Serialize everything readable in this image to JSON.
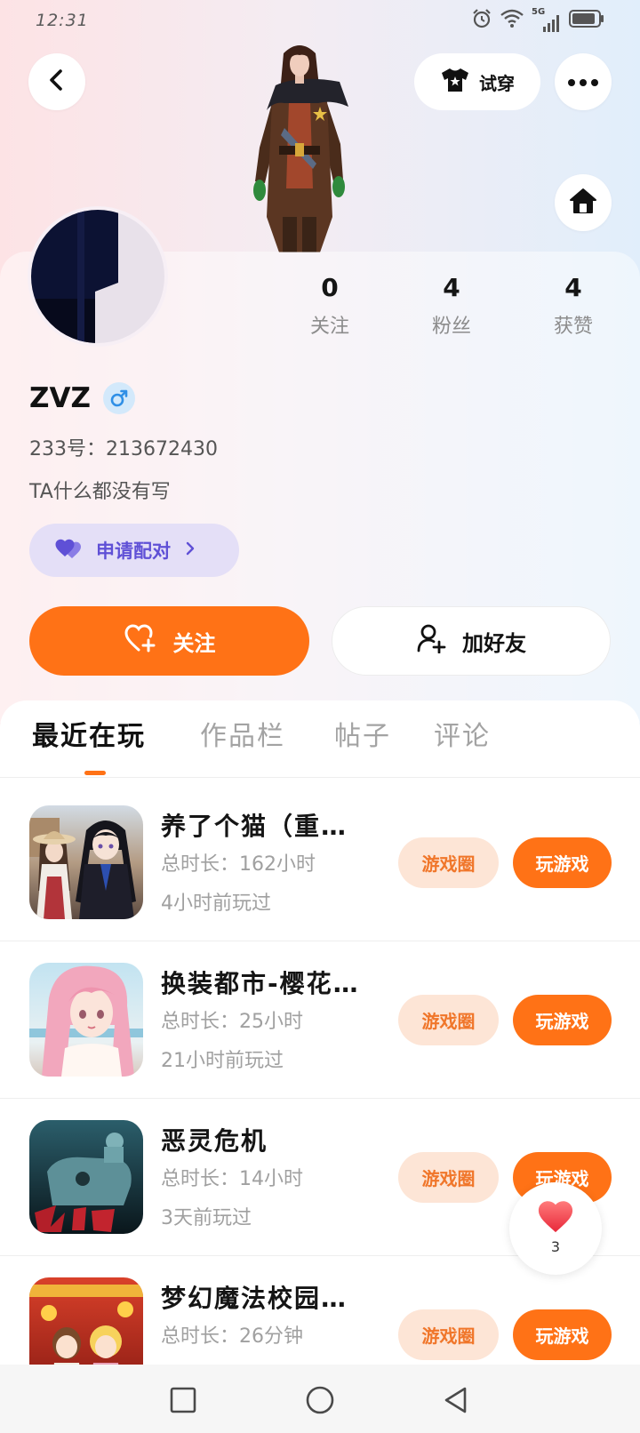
{
  "status_bar": {
    "time": "12:31",
    "network": "5G",
    "icons": [
      "alarm-icon",
      "wifi-icon",
      "signal-icon",
      "battery-icon"
    ]
  },
  "header": {
    "try_on_label": "试穿",
    "icons": {
      "back": "chevron-left-icon",
      "try_on": "tshirt-icon",
      "more": "more-dots-icon",
      "home": "home-icon"
    }
  },
  "profile": {
    "stats": [
      {
        "value": "0",
        "label": "关注"
      },
      {
        "value": "4",
        "label": "粉丝"
      },
      {
        "value": "4",
        "label": "获赞"
      }
    ],
    "name": "ZVZ",
    "gender_icon": "male-icon",
    "id_line": "233号：213672430",
    "bio": "TA什么都没有写",
    "match_button": {
      "label": "申请配对",
      "icon": "heart-icon"
    }
  },
  "actions": {
    "follow": {
      "label": "关注",
      "icon": "heart-plus-icon"
    },
    "add_friend": {
      "label": "加好友",
      "icon": "person-plus-icon"
    }
  },
  "tabs": [
    {
      "label": "最近在玩",
      "active": true
    },
    {
      "label": "作品栏",
      "active": false
    },
    {
      "label": "帖子",
      "active": false
    },
    {
      "label": "评论",
      "active": false
    }
  ],
  "games": [
    {
      "title": "养了个猫（重…",
      "total_time": "总时长：162小时",
      "last_played": "4小时前玩过",
      "circle_label": "游戏圈",
      "play_label": "玩游戏"
    },
    {
      "title": "换装都市-樱花…",
      "total_time": "总时长：25小时",
      "last_played": "21小时前玩过",
      "circle_label": "游戏圈",
      "play_label": "玩游戏"
    },
    {
      "title": "恶灵危机",
      "total_time": "总时长：14小时",
      "last_played": "3天前玩过",
      "circle_label": "游戏圈",
      "play_label": "玩游戏"
    },
    {
      "title": "梦幻魔法校园…",
      "total_time": "总时长：26分钟",
      "circle_label": "游戏圈",
      "play_label": "玩游戏"
    }
  ],
  "floating_like": {
    "count": "3",
    "icon": "heart-icon"
  },
  "system_nav": {
    "icons": [
      "recents-square-icon",
      "home-circle-icon",
      "back-triangle-icon"
    ]
  },
  "colors": {
    "accent": "#ff7216",
    "accent_soft": "#fde5d6",
    "accent_text": "#f0762a",
    "purple": "#5f50d6",
    "lavender": "#e4dff7",
    "male_blue": "#2f8fe6",
    "male_bg": "#d3e9fb",
    "like_red": "#ee3a45"
  }
}
